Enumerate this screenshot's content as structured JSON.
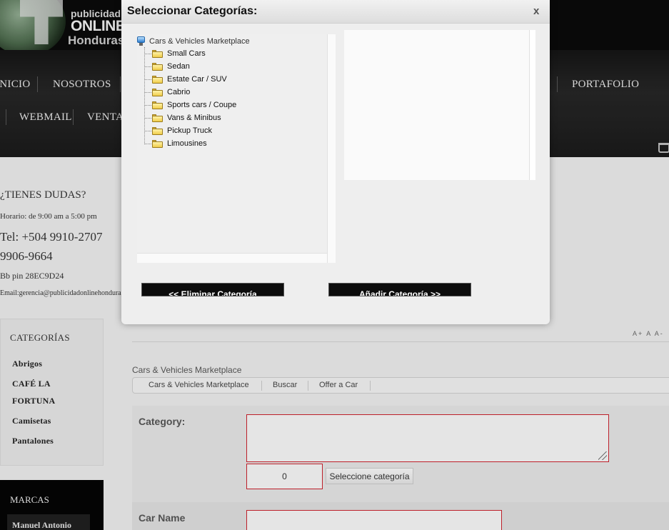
{
  "site": {
    "logo_small": "publicidad",
    "logo_big": "ONLINE",
    "logo_region": "Honduras",
    "nav_row1": [
      "INICIO",
      "NOSOTROS",
      "PORTAFOLIO"
    ],
    "nav_row2": [
      "WEBMAIL",
      "VENTA"
    ]
  },
  "contact": {
    "title": "¿TIENES DUDAS?",
    "hours": "Horario: de 9:00 am a 5:00 pm",
    "phone1": "Tel: +504 9910-2707",
    "phone2": "9906-9664",
    "bbpin": "Bb pin 28EC9D24",
    "email": "Email:gerencia@publicidadonlinehonduras.com"
  },
  "categories": {
    "title": "CATEGORÍAS",
    "items": [
      "Abrigos",
      "CAFÉ LA",
      "FORTUNA",
      "Camisetas",
      "Pantalones"
    ]
  },
  "marcas": {
    "title": "MARCAS",
    "items": [
      "Manuel Antonio"
    ]
  },
  "font_tools": "A+ A A-",
  "breadcrumb": "Cars & Vehicles Marketplace",
  "subnav": [
    "Cars & Vehicles Marketplace",
    "Buscar",
    "Offer a Car"
  ],
  "form": {
    "category_label": "Category:",
    "category_count": "0",
    "select_category_button": "Seleccione categoría",
    "car_name_label": "Car Name"
  },
  "modal": {
    "title": "Seleccionar Categorías:",
    "close": "x",
    "tree_root": "Cars & Vehicles Marketplace",
    "tree_items": [
      "Small Cars",
      "Sedan",
      "Estate Car / SUV",
      "Cabrio",
      "Sports cars / Coupe",
      "Vans & Minibus",
      "Pickup Truck",
      "Limousines"
    ],
    "remove_button": "<< Eliminar Categoría",
    "add_button": "Añadir Categoría >>"
  },
  "colors": {
    "error_border": "#c9232d",
    "header_bg": "#0a0a0a",
    "modal_button_bg": "#0c0c0c"
  }
}
